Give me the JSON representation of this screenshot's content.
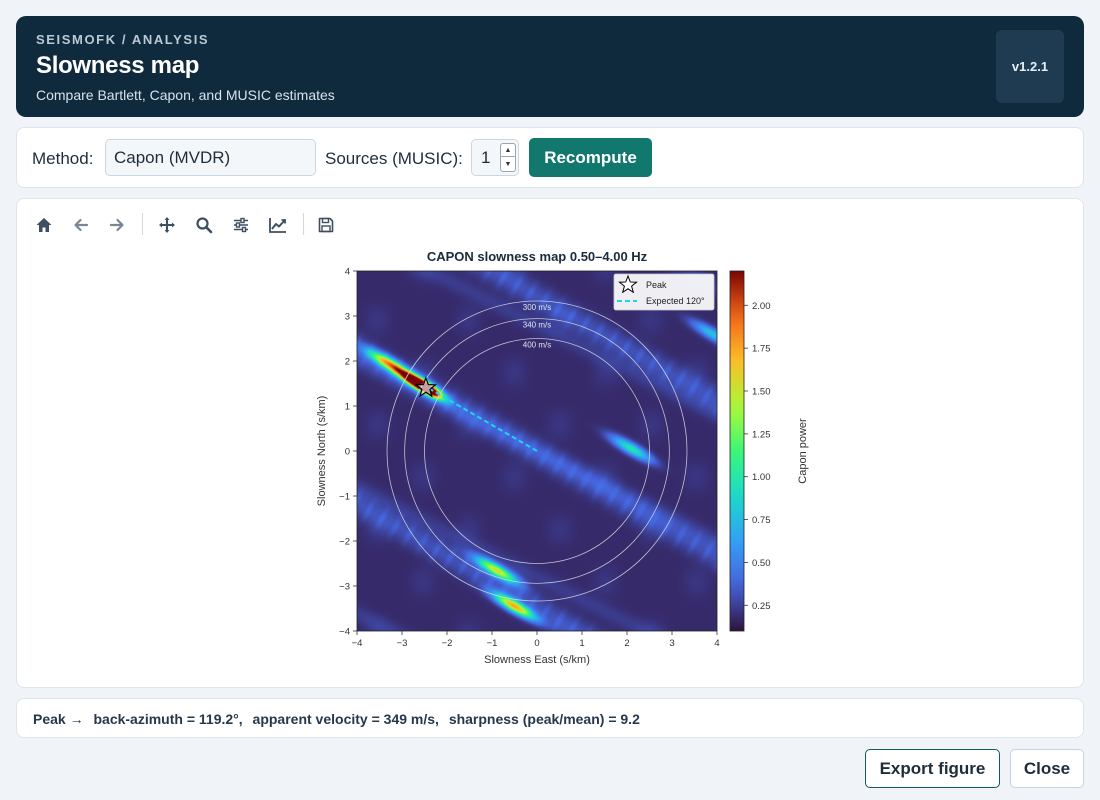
{
  "header": {
    "breadcrumb": "SEISMOFK / ANALYSIS",
    "title": "Slowness map",
    "subtitle": "Compare Bartlett, Capon, and MUSIC estimates",
    "version": "v1.2.1"
  },
  "controls": {
    "method_label": "Method:",
    "method_value": "Capon (MVDR)",
    "sources_label": "Sources (MUSIC):",
    "sources_value": "1",
    "recompute_label": "Recompute"
  },
  "toolbar": {
    "icons": [
      "home-icon",
      "back-arrow-icon",
      "forward-arrow-icon",
      "pan-icon",
      "zoom-icon",
      "configure-subplots-icon",
      "edit-axis-icon",
      "save-icon"
    ]
  },
  "chart_data": {
    "type": "heatmap",
    "title": "CAPON slowness map   0.50–4.00 Hz",
    "xlabel": "Slowness East  (s/km)",
    "ylabel": "Slowness North  (s/km)",
    "xlim": [
      -4,
      4
    ],
    "ylim": [
      -4,
      4
    ],
    "x_ticks": [
      "−4",
      "−3",
      "−2",
      "−1",
      "0",
      "1",
      "2",
      "3",
      "4"
    ],
    "y_ticks": [
      "−4",
      "−3",
      "−2",
      "−1",
      "0",
      "1",
      "2",
      "3",
      "4"
    ],
    "colorbar": {
      "label": "Capon power",
      "ticks": [
        "0.25",
        "0.50",
        "0.75",
        "1.00",
        "1.25",
        "1.50",
        "1.75",
        "2.00"
      ],
      "tick_values": [
        0.25,
        0.5,
        0.75,
        1.0,
        1.25,
        1.5,
        1.75,
        2.0
      ],
      "range": [
        0.1,
        2.2
      ],
      "colormap": "turbo"
    },
    "velocity_circles": [
      {
        "label": "300 m/s",
        "radius_s_per_km": 3.333
      },
      {
        "label": "340 m/s",
        "radius_s_per_km": 2.941
      },
      {
        "label": "400 m/s",
        "radius_s_per_km": 2.5
      }
    ],
    "peak": {
      "sx": -2.47,
      "sy": 1.4,
      "power": 2.2
    },
    "expected_line": {
      "azimuth_deg": 120,
      "from": [
        0,
        0
      ],
      "to": [
        -2.47,
        1.43
      ]
    },
    "legend": {
      "placement": "top-right",
      "entries": [
        "Peak",
        "Expected 120°"
      ]
    },
    "ridges": [
      {
        "sx": -3.3,
        "sy": 1.95,
        "power": 1.6
      },
      {
        "sx": -2.7,
        "sy": 1.55,
        "power": 2.0
      },
      {
        "sx": -0.9,
        "sy": -2.65,
        "power": 1.5
      },
      {
        "sx": -0.5,
        "sy": -3.45,
        "power": 1.7
      },
      {
        "sx": 2.1,
        "sy": 0.05,
        "power": 1.0
      },
      {
        "sx": 3.9,
        "sy": 2.6,
        "power": 0.8
      }
    ]
  },
  "status": {
    "prefix": "Peak →",
    "back_azimuth": "back-azimuth = 119.2°,",
    "apparent_velocity": "apparent velocity = 349 m/s,",
    "sharpness": "sharpness (peak/mean) = 9.2"
  },
  "footer": {
    "export_label": "Export figure",
    "close_label": "Close"
  }
}
